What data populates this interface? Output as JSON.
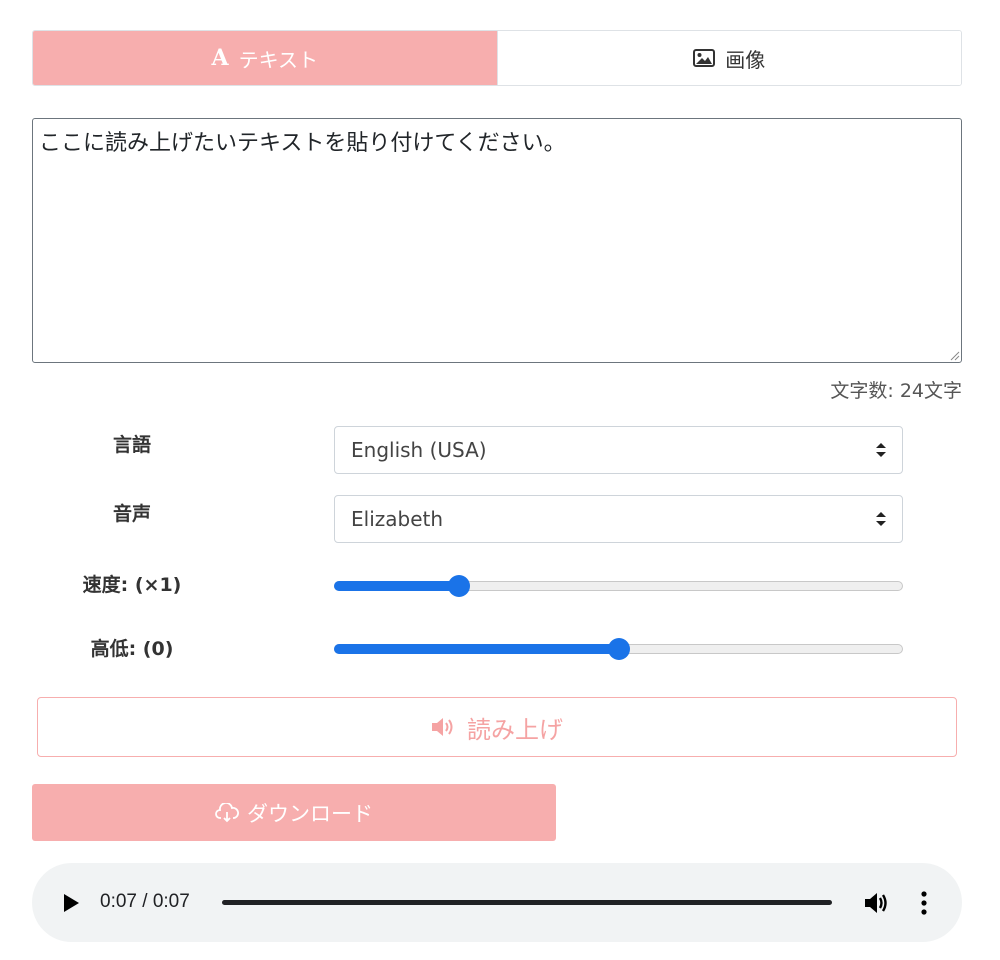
{
  "tabs": {
    "text_tab": {
      "label": "テキスト",
      "icon": "letter-a-icon"
    },
    "image_tab": {
      "label": "画像",
      "icon": "image-icon"
    }
  },
  "textarea": {
    "value": "ここに読み上げたいテキストを貼り付けてください。"
  },
  "char_count": "文字数: 24文字",
  "settings": {
    "language": {
      "label": "言語",
      "value": "English (USA)"
    },
    "voice": {
      "label": "音声",
      "value": "Elizabeth"
    },
    "speed": {
      "label": "速度: (×1)",
      "fraction": 0.22
    },
    "pitch": {
      "label": "高低: (0)",
      "fraction": 0.5
    }
  },
  "buttons": {
    "read_label": "読み上げ",
    "download_label": "ダウンロード"
  },
  "player": {
    "time": "0:07 / 0:07"
  },
  "colors": {
    "accent": "#f7aeae",
    "slider": "#1a73e8"
  }
}
